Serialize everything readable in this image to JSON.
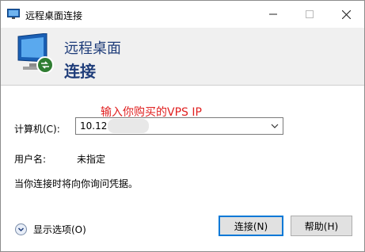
{
  "window": {
    "title": "远程桌面连接",
    "controls": {
      "minimize": "minimize",
      "maximize": "maximize",
      "close": "close"
    }
  },
  "banner": {
    "line1": "远程桌面",
    "line2": "连接"
  },
  "annotation": {
    "text": "输入你购买的VPS IP",
    "color": "#e02020"
  },
  "form": {
    "computer_label": "计算机(C):",
    "computer_value": "10.128",
    "user_label": "用户名:",
    "user_value": "未指定",
    "hint": "当你连接时将向你询问凭据。"
  },
  "footer": {
    "options_label": "显示选项(O)",
    "connect_label": "连接(N)",
    "help_label": "帮助(H)"
  },
  "colors": {
    "accent": "#0078d7",
    "banner_text": "#1f3d7a"
  }
}
